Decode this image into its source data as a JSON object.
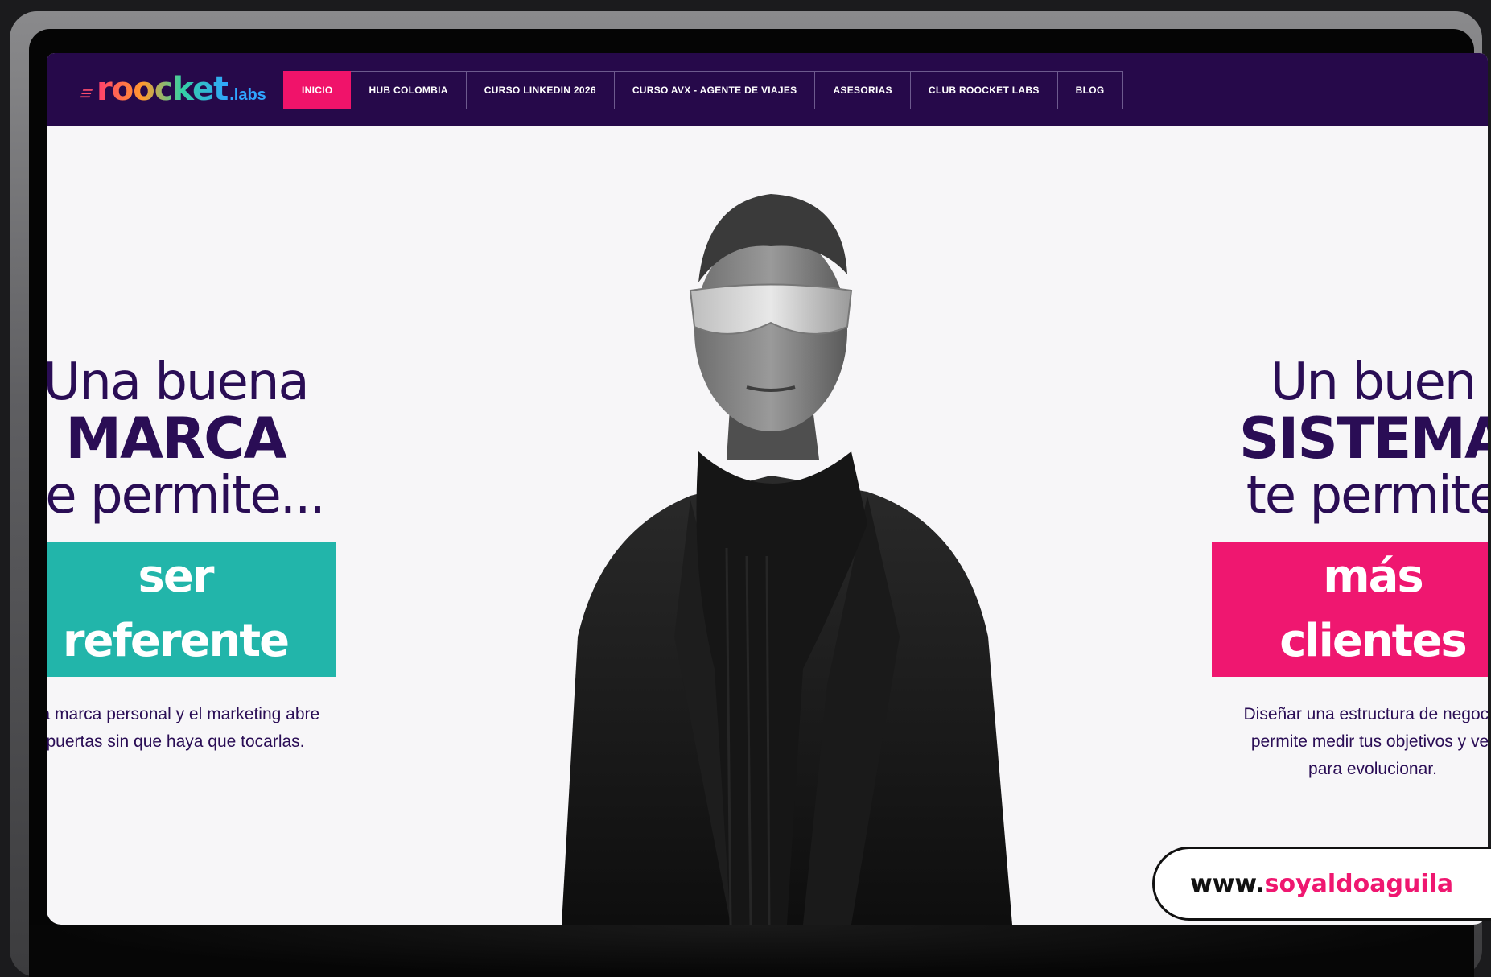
{
  "brand": {
    "logo_main": "roocket",
    "logo_sub": ".labs"
  },
  "nav": {
    "items": [
      {
        "label": "INICIO",
        "active": true
      },
      {
        "label": "HUB COLOMBIA"
      },
      {
        "label": "CURSO LINKEDIN 2026"
      },
      {
        "label": "CURSO AVX - AGENTE DE VIAJES"
      },
      {
        "label": "ASESORIAS"
      },
      {
        "label": "CLUB ROOCKET LABS"
      },
      {
        "label": "BLOG"
      }
    ]
  },
  "hero_left": {
    "line1": "Una buena",
    "line2": "MARCA",
    "line3": "te permite...",
    "pill": "ser referente",
    "para1": "La marca personal y el marketing abre",
    "para2": "puertas sin que haya que tocarlas."
  },
  "hero_right": {
    "line1": "Un buen",
    "line2": "SISTEMA",
    "line3": "te permite",
    "pill": "más clientes",
    "para1": "Diseñar una estructura de negocio",
    "para2": "permite medir tus objetivos y ver",
    "para3": "para evolucionar."
  },
  "url_badge": {
    "prefix": "www.",
    "domain": "soyaldoaguila"
  },
  "colors": {
    "nav_bg": "#26094a",
    "accent_pink": "#ef1770",
    "accent_teal": "#22b5aa",
    "heading": "#2a0d55"
  }
}
